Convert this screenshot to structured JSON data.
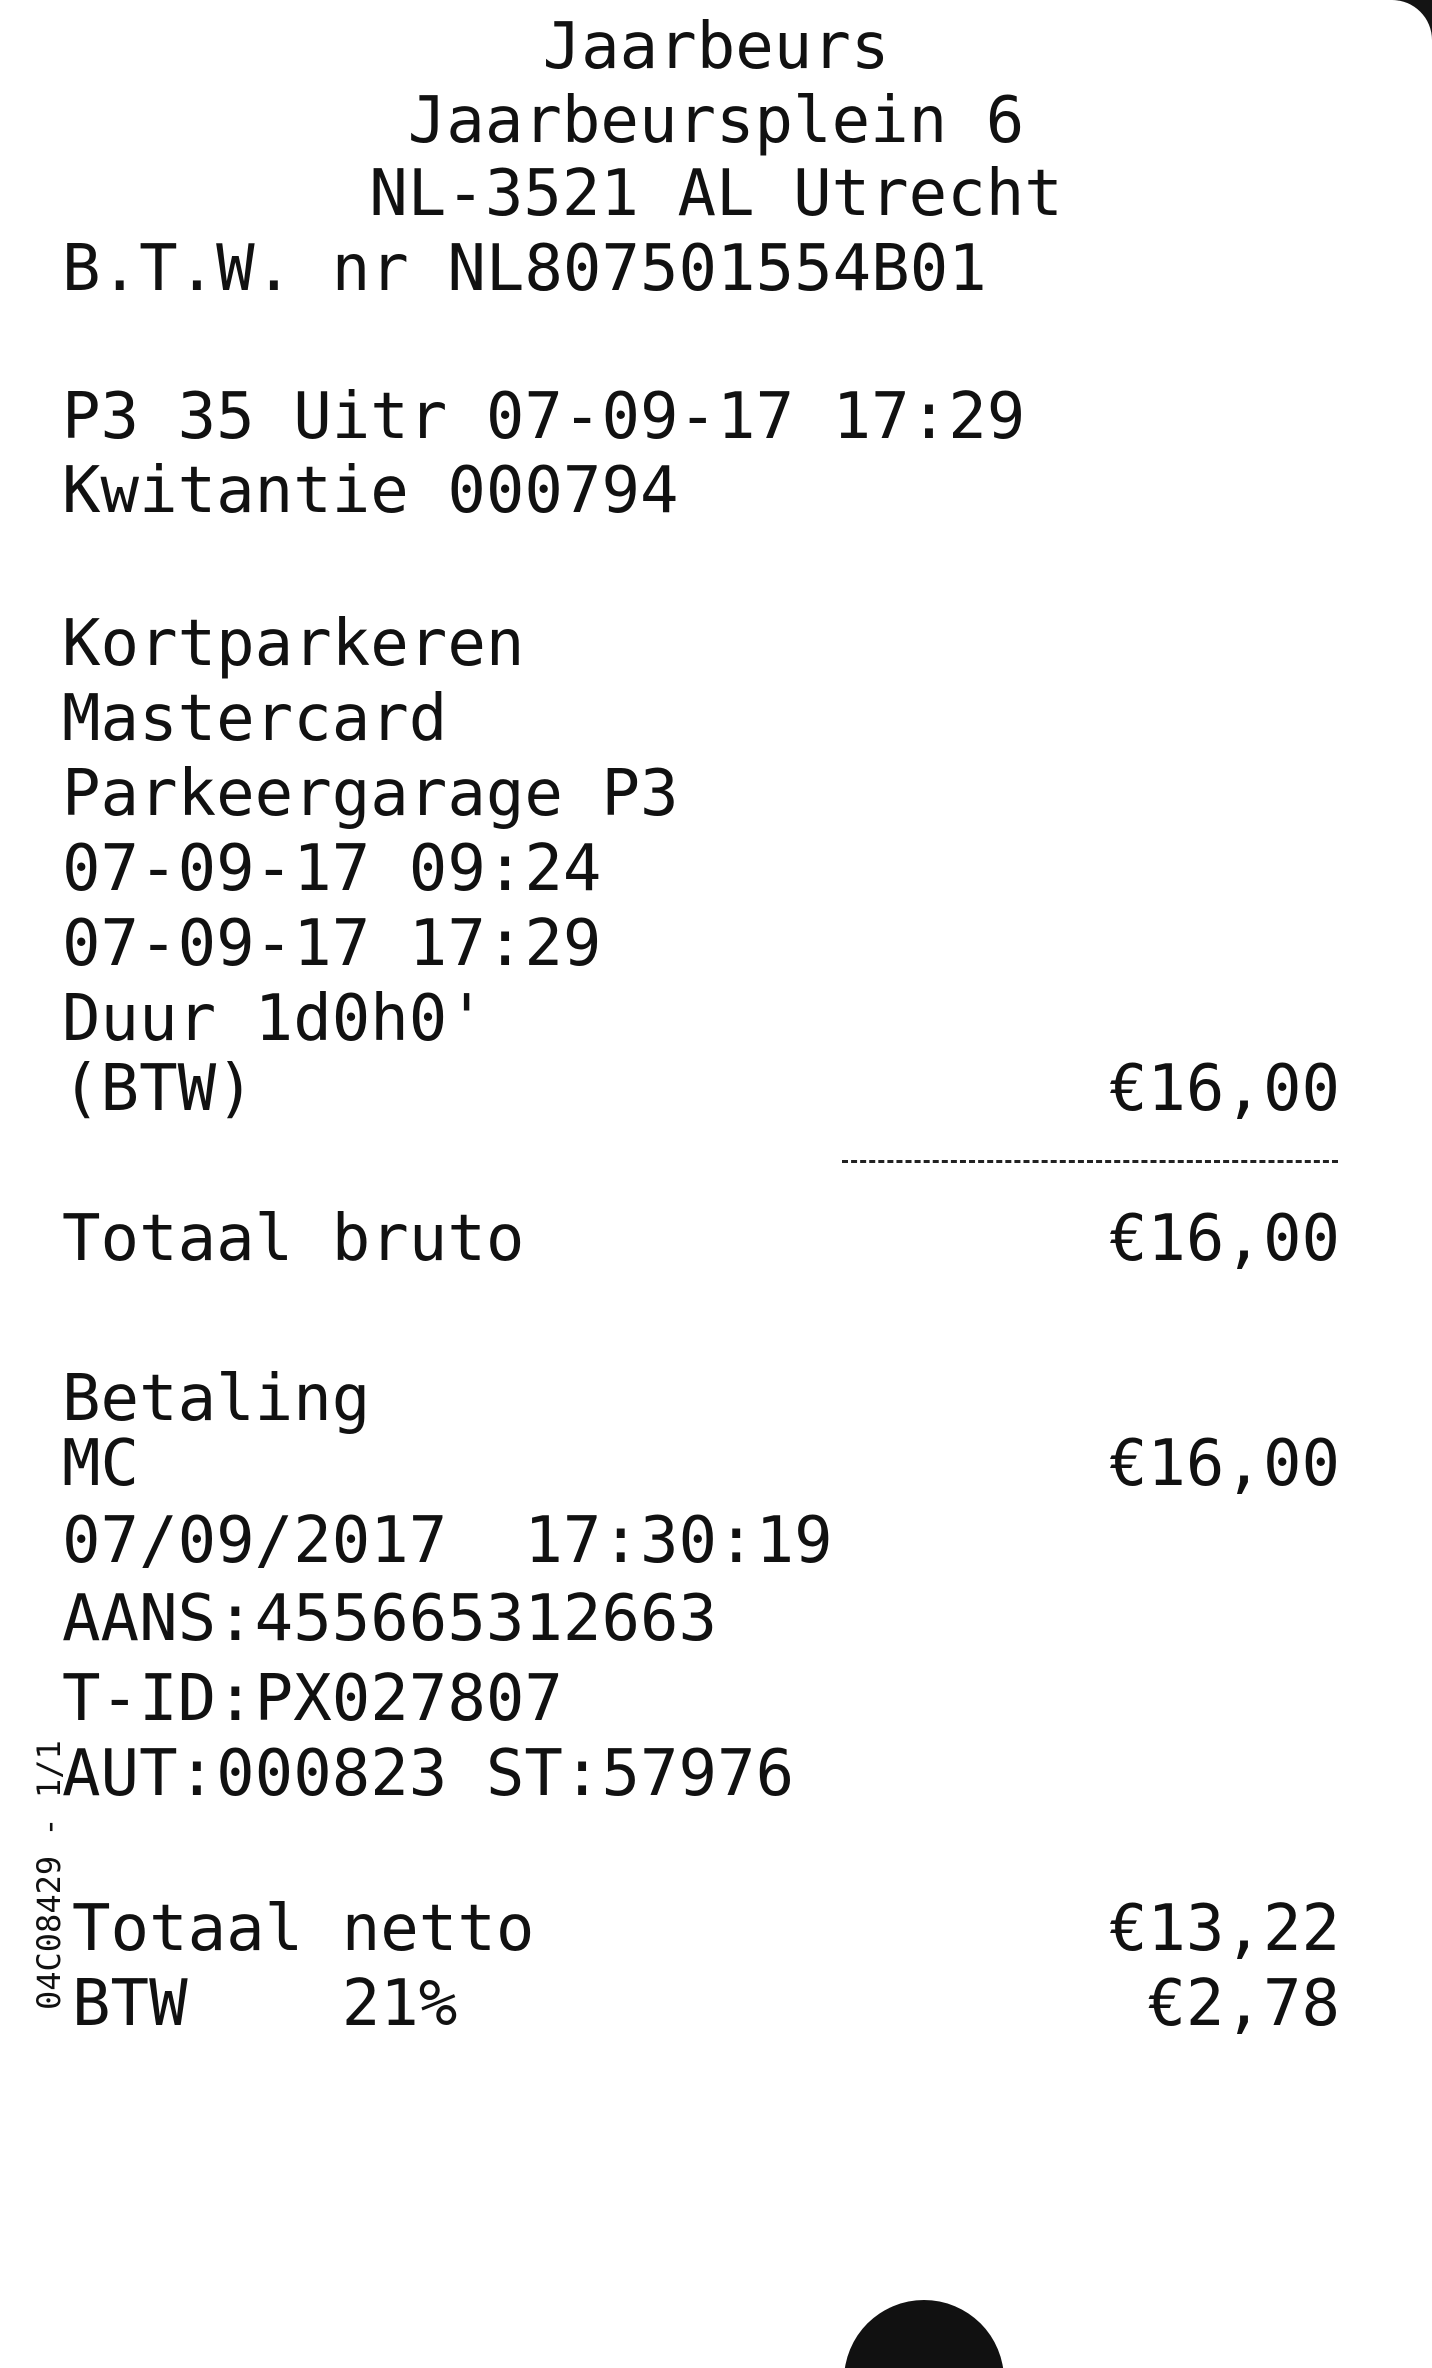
{
  "header": {
    "name": "Jaarbeurs",
    "street": "Jaarbeursplein 6",
    "city": "NL-3521 AL Utrecht",
    "vat": "B.T.W. nr NL807501554B01"
  },
  "terminal_line": "P3 35 Uitr 07-09-17 17:29",
  "receipt_line": "Kwitantie 000794",
  "parking": {
    "type": "Kortparkeren",
    "card": "Mastercard",
    "garage": "Parkeergarage P3",
    "entry": "07-09-17 09:24",
    "exit": "07-09-17 17:29",
    "duration": "Duur 1d0h0'",
    "btw_label": "(BTW)",
    "btw_amount": "€16,00"
  },
  "gross": {
    "label": "Totaal bruto",
    "amount": "€16,00"
  },
  "payment": {
    "title": "Betaling",
    "method": "MC",
    "amount": "€16,00",
    "datetime": "07/09/2017  17:30:19",
    "aans": "AANS:455665312663",
    "tid": "T-ID:PX027807",
    "aut": "AUT:000823 ST:57976"
  },
  "net": {
    "label": "Totaal netto",
    "amount": "€13,22"
  },
  "vat_line": {
    "label": "BTW    21%",
    "amount": "€2,78"
  },
  "side_code": "04C08429 - 1/1"
}
